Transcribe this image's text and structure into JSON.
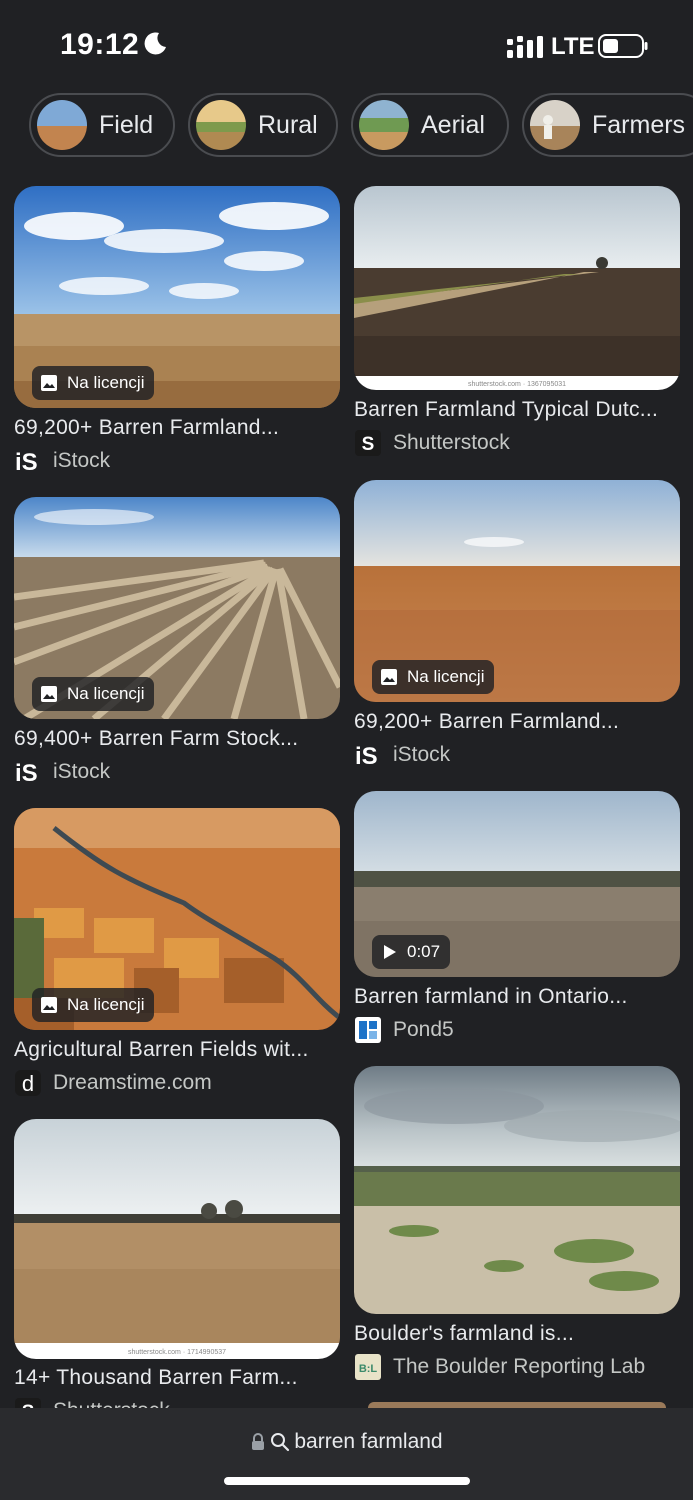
{
  "status_bar": {
    "time": "19:12",
    "network": "LTE"
  },
  "chips": [
    {
      "label": "Field"
    },
    {
      "label": "Rural"
    },
    {
      "label": "Aerial"
    },
    {
      "label": "Farmers"
    }
  ],
  "results": [
    {
      "title": "69,200+ Barren Farmland...",
      "source": "iStock",
      "badge": "Na licencji",
      "source_icon": "istock-logo-icon"
    },
    {
      "title": "Barren Farmland Typical Dutc...",
      "source": "Shutterstock",
      "watermark": "shutterstock.com · 1367095031",
      "source_icon": "shutterstock-logo-icon"
    },
    {
      "title": "69,400+ Barren Farm Stock...",
      "source": "iStock",
      "badge": "Na licencji",
      "source_icon": "istock-logo-icon"
    },
    {
      "title": "69,200+ Barren Farmland...",
      "source": "iStock",
      "badge": "Na licencji",
      "source_icon": "istock-logo-icon"
    },
    {
      "title": "Agricultural Barren Fields wit...",
      "source": "Dreamstime.com",
      "badge": "Na licencji",
      "source_icon": "dreamstime-logo-icon"
    },
    {
      "title": "Barren farmland in Ontario...",
      "source": "Pond5",
      "badge": "0:07",
      "source_icon": "pond5-logo-icon"
    },
    {
      "title": "14+ Thousand Barren Farm...",
      "source": "Shutterstock",
      "watermark": "shutterstock.com · 1714990537",
      "source_icon": "shutterstock-logo-icon"
    },
    {
      "title": "Boulder's farmland is...",
      "source": "The Boulder Reporting Lab",
      "source_icon": "boulder-reporting-lab-logo-icon"
    }
  ],
  "address_bar": {
    "query": "barren farmland"
  },
  "colors": {
    "background": "#202124",
    "chip_border": "#4a4c50",
    "text": "#e8eaed",
    "source_text": "#c4c7c5"
  }
}
